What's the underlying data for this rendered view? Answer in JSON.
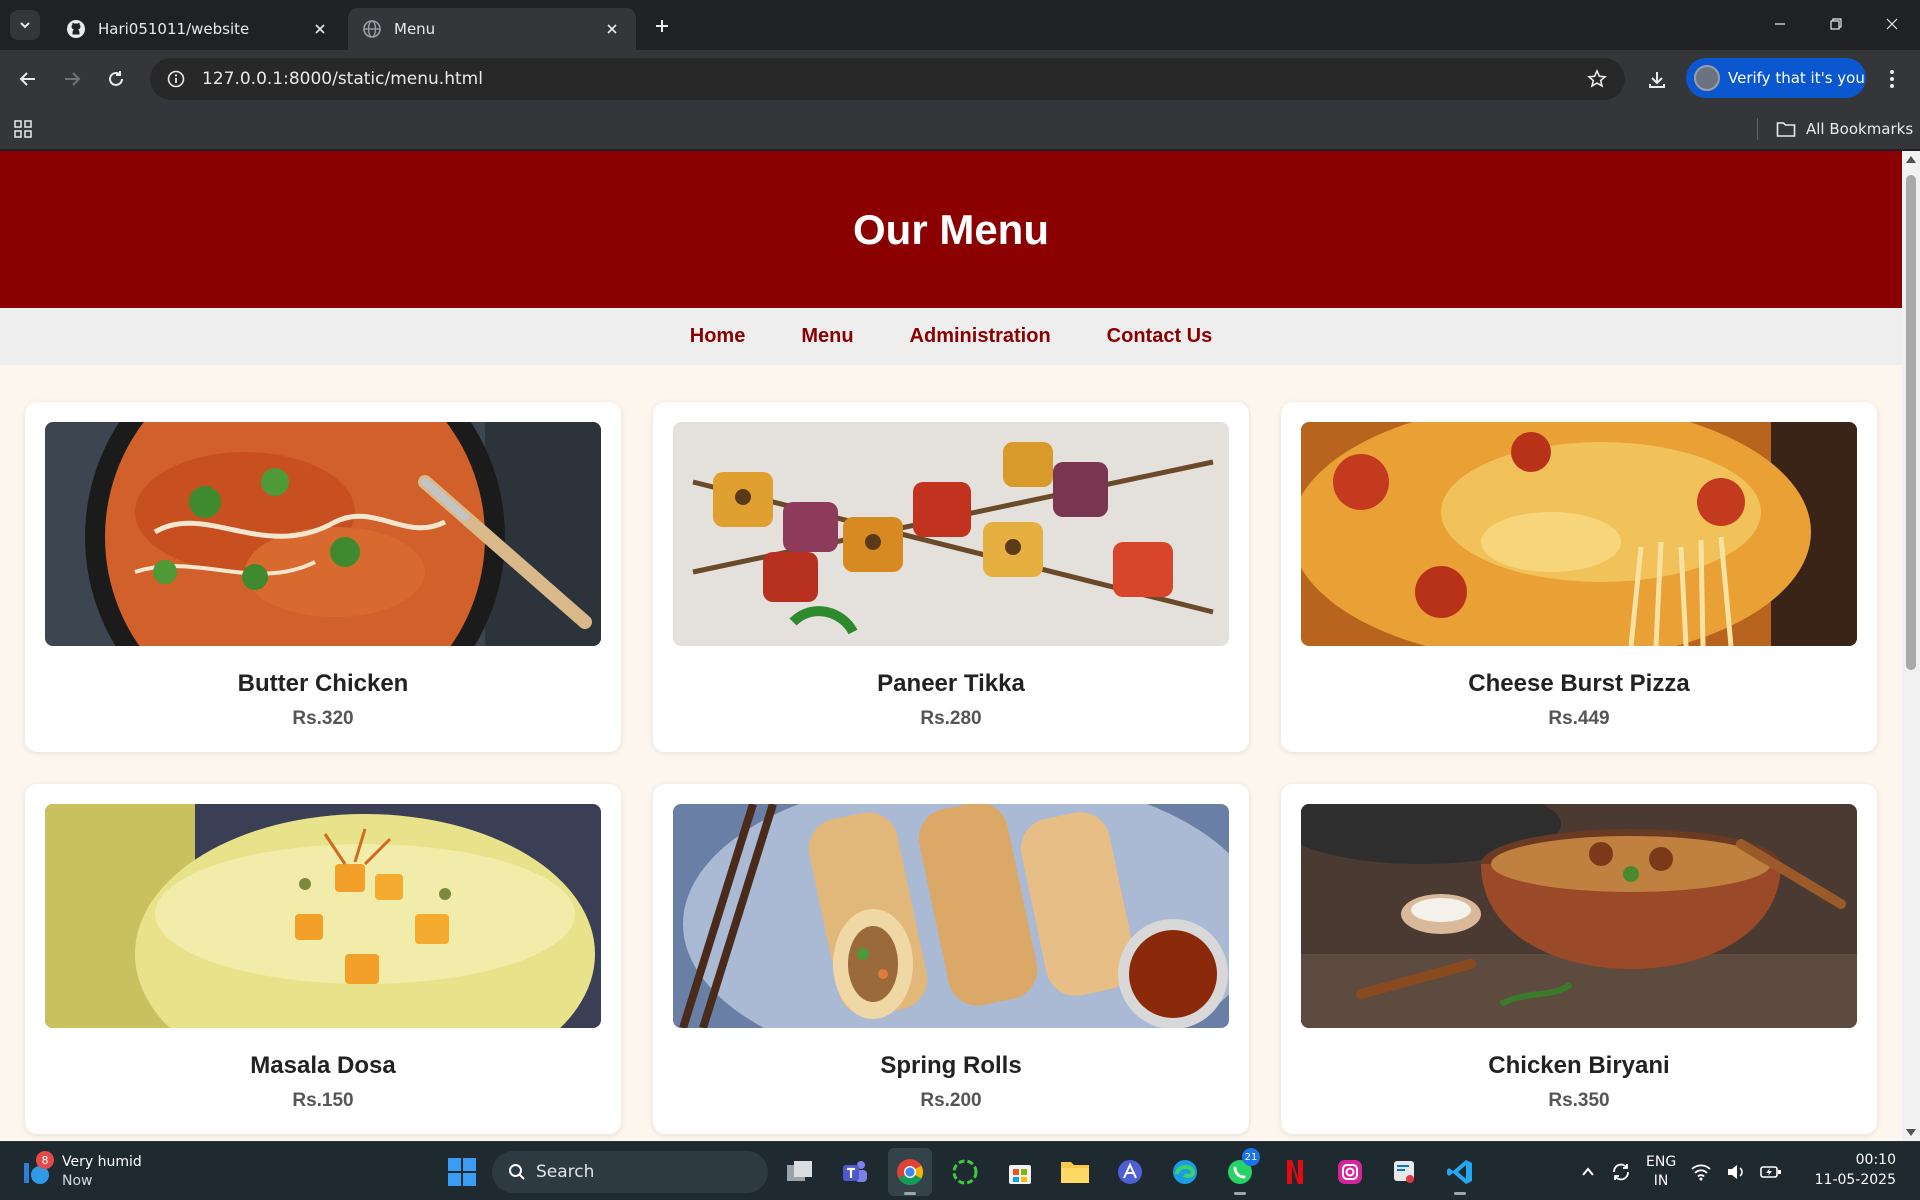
{
  "browser": {
    "tabs": [
      {
        "title": "Hari051011/website",
        "favicon": "github-icon",
        "active": false
      },
      {
        "title": "Menu",
        "favicon": "globe-icon",
        "active": true
      }
    ],
    "url": "127.0.0.1:8000/static/menu.html",
    "verify_label": "Verify that it's you",
    "all_bookmarks_label": "All Bookmarks"
  },
  "page": {
    "title": "Our Menu",
    "nav": [
      "Home",
      "Menu",
      "Administration",
      "Contact Us"
    ],
    "items": [
      {
        "name": "Butter Chicken",
        "price": "Rs.320",
        "image": "butter-chicken-image"
      },
      {
        "name": "Paneer Tikka",
        "price": "Rs.280",
        "image": "paneer-tikka-image"
      },
      {
        "name": "Cheese Burst Pizza",
        "price": "Rs.449",
        "image": "cheese-pizza-image"
      },
      {
        "name": "Masala Dosa",
        "price": "Rs.150",
        "image": "mango-lassi-image"
      },
      {
        "name": "Spring Rolls",
        "price": "Rs.200",
        "image": "spring-rolls-image"
      },
      {
        "name": "Chicken Biryani",
        "price": "Rs.350",
        "image": "chicken-biryani-image"
      }
    ],
    "colors": {
      "header": "#8b0000",
      "nav_link": "#8b0000",
      "background": "#fdf6ee"
    }
  },
  "taskbar": {
    "weather": {
      "title": "Very humid",
      "subtitle": "Now",
      "badge": "8"
    },
    "search_label": "Search",
    "whatsapp_badge": "21",
    "language": {
      "line1": "ENG",
      "line2": "IN"
    },
    "time": "00:10",
    "date": "11-05-2025"
  }
}
